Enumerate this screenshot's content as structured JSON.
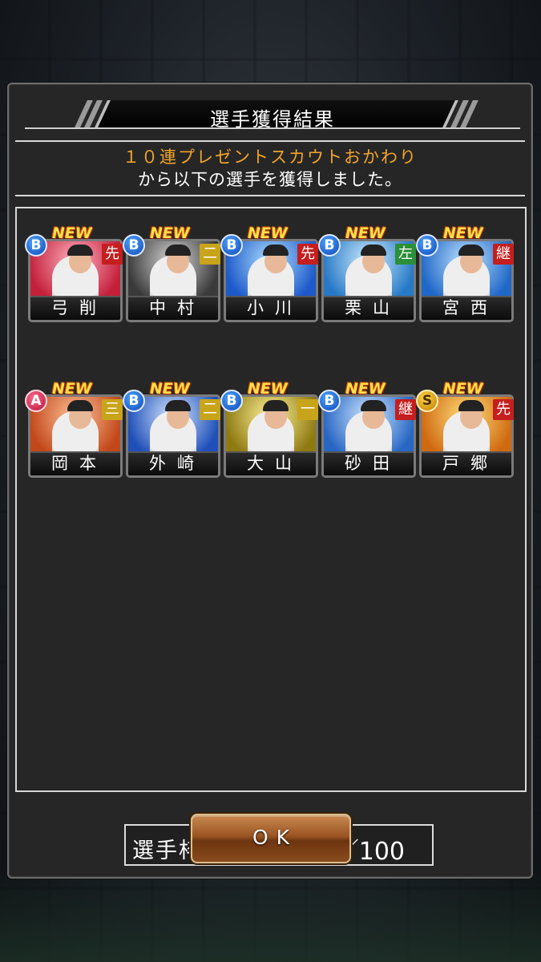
{
  "dialog": {
    "title": "選手獲得結果",
    "message_line1": "１０連プレゼントスカウトおかわり",
    "message_line2": "から以下の選手を獲得しました。"
  },
  "cards": [
    {
      "name": "弓削",
      "rank": "B",
      "position": "先",
      "new_label": "NEW",
      "pos_color": "#c51e1e",
      "bg": [
        "#ffb2c2",
        "#c4203a"
      ]
    },
    {
      "name": "中村",
      "rank": "B",
      "position": "二",
      "new_label": "NEW",
      "pos_color": "#c8a41a",
      "bg": [
        "#d8d8d8",
        "#3a3a3a"
      ]
    },
    {
      "name": "小川",
      "rank": "B",
      "position": "先",
      "new_label": "NEW",
      "pos_color": "#c51e1e",
      "bg": [
        "#aee0ff",
        "#1d59c9"
      ]
    },
    {
      "name": "栗山",
      "rank": "B",
      "position": "左",
      "new_label": "NEW",
      "pos_color": "#2c8f3a",
      "bg": [
        "#cfeeff",
        "#2779c6"
      ]
    },
    {
      "name": "宮西",
      "rank": "B",
      "position": "継",
      "new_label": "NEW",
      "pos_color": "#c51e1e",
      "bg": [
        "#bfe4ff",
        "#2068c8"
      ]
    },
    {
      "name": "岡本",
      "rank": "A",
      "position": "三",
      "new_label": "NEW",
      "pos_color": "#c8a41a",
      "bg": [
        "#ffc39a",
        "#c2481a"
      ]
    },
    {
      "name": "外崎",
      "rank": "B",
      "position": "二",
      "new_label": "NEW",
      "pos_color": "#c8a41a",
      "bg": [
        "#d6e8ff",
        "#1f4fb8"
      ]
    },
    {
      "name": "大山",
      "rank": "B",
      "position": "一",
      "new_label": "NEW",
      "pos_color": "#c8a41a",
      "bg": [
        "#fff39a",
        "#8f7a12"
      ]
    },
    {
      "name": "砂田",
      "rank": "B",
      "position": "継",
      "new_label": "NEW",
      "pos_color": "#c51e1e",
      "bg": [
        "#cfe8ff",
        "#2866c4"
      ]
    },
    {
      "name": "戸郷",
      "rank": "S",
      "position": "先",
      "new_label": "NEW",
      "pos_color": "#c51e1e",
      "bg": [
        "#ffe07a",
        "#d06a12"
      ]
    }
  ],
  "roster": {
    "label": "選手枠：",
    "value": "40／100"
  },
  "ok_button": {
    "label": "OK"
  }
}
